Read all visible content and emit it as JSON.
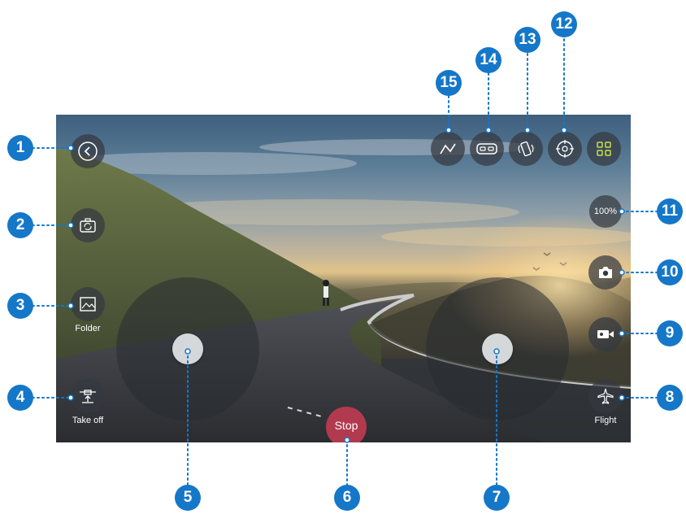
{
  "colors": {
    "callout": "#1577c8",
    "stop_button": "#b23a4f",
    "button_bg": "#343940",
    "grid_icon_accent": "#c8e04b"
  },
  "controls": {
    "back": {
      "icon": "chevron-left-icon"
    },
    "camera_switch": {
      "icon": "camera-rotate-icon"
    },
    "folder": {
      "icon": "gallery-icon",
      "label": "Folder"
    },
    "takeoff": {
      "icon": "takeoff-icon",
      "label": "Take off"
    },
    "stop": {
      "label": "Stop"
    },
    "flight": {
      "icon": "airplane-icon",
      "label": "Flight"
    },
    "video": {
      "icon": "video-camera-icon"
    },
    "photo": {
      "icon": "camera-icon"
    },
    "zoom": {
      "label": "100%"
    },
    "gyro": {
      "icon": "crosshair-icon"
    },
    "rotate": {
      "icon": "phone-rotate-icon"
    },
    "vr": {
      "icon": "vr-headset-icon"
    },
    "route": {
      "icon": "flight-path-icon"
    },
    "menu": {
      "icon": "grid-icon"
    }
  },
  "joysticks": {
    "left": {
      "knob_offset_x": 0,
      "knob_offset_y": 0.0
    },
    "right": {
      "knob_offset_x": 0,
      "knob_offset_y": 0.0
    }
  },
  "callouts": [
    "1",
    "2",
    "3",
    "4",
    "5",
    "6",
    "7",
    "8",
    "9",
    "10",
    "11",
    "12",
    "13",
    "14",
    "15"
  ]
}
